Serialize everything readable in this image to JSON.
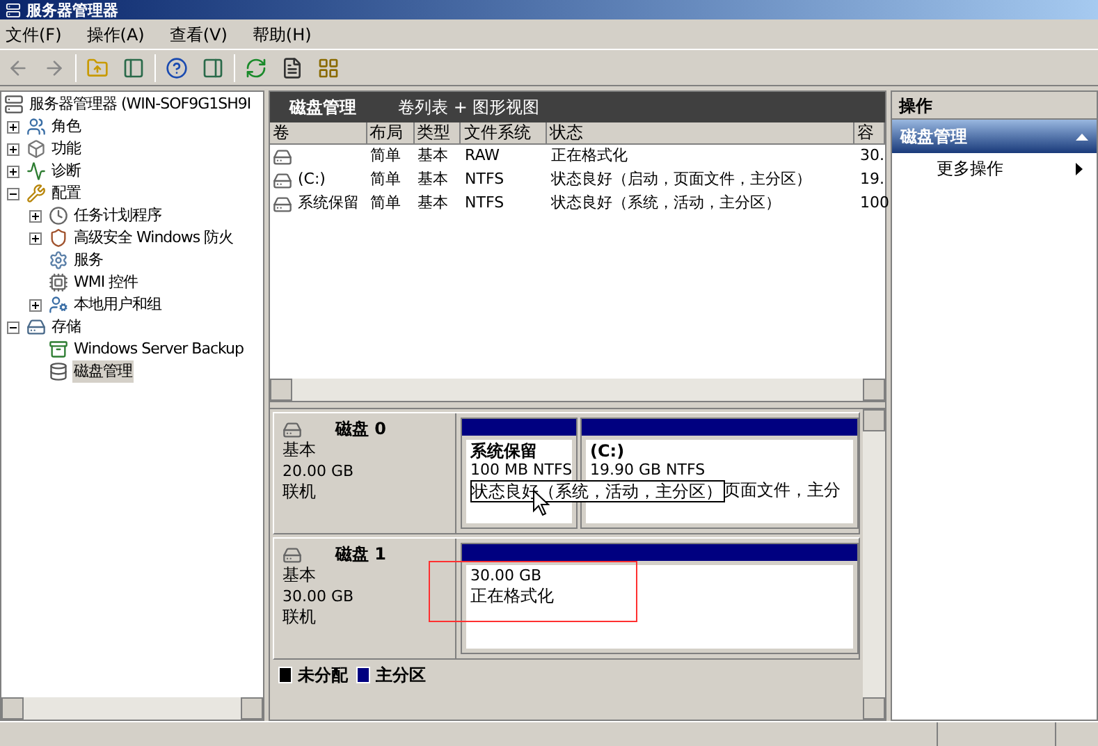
{
  "window": {
    "title": "服务器管理器"
  },
  "menu": [
    "文件(F)",
    "操作(A)",
    "查看(V)",
    "帮助(H)"
  ],
  "tree": {
    "label": "服务器管理器 (WIN-SOF9G1SH9I",
    "selected": false,
    "children": [
      {
        "label": "角色",
        "expanded": false,
        "selected": false
      },
      {
        "label": "功能",
        "expanded": false,
        "selected": false
      },
      {
        "label": "诊断",
        "expanded": false,
        "selected": false
      },
      {
        "label": "配置",
        "expanded": true,
        "selected": false,
        "children": [
          {
            "label": "任务计划程序",
            "expanded": false,
            "selected": false
          },
          {
            "label": "高级安全 Windows 防火",
            "expanded": false,
            "selected": false
          },
          {
            "label": "服务",
            "selected": false
          },
          {
            "label": "WMI 控件",
            "selected": false
          },
          {
            "label": "本地用户和组",
            "expanded": false,
            "selected": false
          }
        ]
      },
      {
        "label": "存储",
        "expanded": true,
        "selected": false,
        "children": [
          {
            "label": "Windows Server Backup",
            "selected": false
          },
          {
            "label": "磁盘管理",
            "selected": true
          }
        ]
      }
    ]
  },
  "header": {
    "title": "磁盘管理",
    "view": "卷列表 + 图形视图"
  },
  "table": {
    "columns": [
      "卷",
      "布局",
      "类型",
      "文件系统",
      "状态",
      "容"
    ],
    "rows": [
      {
        "layout": "简单",
        "type": "基本",
        "fs": "RAW",
        "status": "正在格式化",
        "capacity": "30."
      },
      {
        "volume": "(C:)",
        "layout": "简单",
        "type": "基本",
        "fs": "NTFS",
        "status": "状态良好（启动，页面文件，主分区）",
        "capacity": "19."
      },
      {
        "volume": "系统保留",
        "layout": "简单",
        "type": "基本",
        "fs": "NTFS",
        "status": "状态良好（系统，活动，主分区）",
        "capacity": "100"
      }
    ]
  },
  "disks": [
    {
      "name": "磁盘 0",
      "type": "基本",
      "size": "20.00 GB",
      "status": "联机",
      "partitions": [
        {
          "name": "系统保留",
          "size": "100 MB NTFS",
          "status": "状态良好（系统，活动，主分区）",
          "focused": true,
          "highlighted": false
        },
        {
          "name": "(C:)",
          "size": "19.90 GB NTFS",
          "status": "页面文件，主分",
          "focused": false,
          "highlighted": false
        }
      ]
    },
    {
      "name": "磁盘 1",
      "type": "基本",
      "size": "30.00 GB",
      "status": "联机",
      "partitions": [
        {
          "size": "30.00 GB",
          "status": "正在格式化",
          "focused": false,
          "highlighted": true
        }
      ]
    }
  ],
  "legend": [
    {
      "label": "未分配",
      "color": "#000000"
    },
    {
      "label": "主分区",
      "color": "#000080"
    }
  ],
  "actions": {
    "title": "操作",
    "sections": [
      {
        "label": "磁盘管理",
        "expanded": true,
        "items": [
          {
            "label": "更多操作",
            "submenu": true
          }
        ]
      }
    ]
  }
}
